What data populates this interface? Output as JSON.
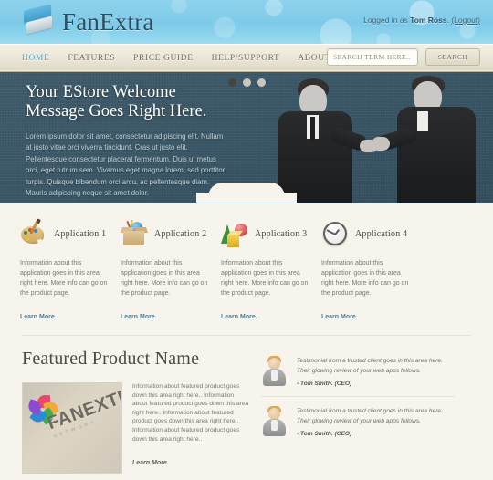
{
  "header": {
    "brand": "FanExtra",
    "logo_icon": "fanextra-logo-icon",
    "logged_in_prefix": "Logged in as ",
    "user_name": "Tom Ross",
    "logged_in_suffix": ". ",
    "logout_label": "(Logout)"
  },
  "nav": {
    "items": [
      {
        "label": "HOME",
        "active": true
      },
      {
        "label": "FEATURES",
        "active": false
      },
      {
        "label": "PRICE GUIDE",
        "active": false
      },
      {
        "label": "HELP/SUPPORT",
        "active": false
      },
      {
        "label": "ABOUT US",
        "active": false
      }
    ],
    "search_placeholder": "SEARCH TERM HERE..",
    "search_value": "",
    "search_button": "SEARCH"
  },
  "hero": {
    "title_line1": "Your EStore Welcome",
    "title_line2": "Message Goes Right Here.",
    "body": "Lorem ipsum dolor sit amet, consectetur adipiscing elit. Nullam at justo vitae orci viverra tincidunt. Cras ut justo elit. Pellentesque consectetur placerat fermentum. Duis ut metus orci, eget rutrum sem. Vivamus eget magna lorem, sed porttitor turpis. Quisque bibendum orci arcu, ac pellentesque diam. Mauris adipiscing neque sit amet dolor.",
    "image_alt": "two-businessmen-handshake-photo",
    "carousel_dots": 3,
    "carousel_active_index": 0
  },
  "apps": [
    {
      "title": "Application 1",
      "icon": "paint-palette-icon",
      "body": "Information about this application goes in this area right here. More info can go on the product page.",
      "link": "Learn More."
    },
    {
      "title": "Application 2",
      "icon": "open-box-package-icon",
      "body": "Information about this application goes in this area right here. More info can go on the product page.",
      "link": "Learn More."
    },
    {
      "title": "Application 3",
      "icon": "geometric-shapes-icon",
      "body": "Information about this application goes in this area right here. More info can go on the product page.",
      "link": "Learn More."
    },
    {
      "title": "Application 4",
      "icon": "clock-icon",
      "body": "Information about this application goes in this area right here. More info can go on the product page.",
      "link": "Learn More."
    }
  ],
  "featured": {
    "title": "Featured Product Name",
    "image_alt": "fanextra-network-product-image",
    "image_wordmark": "FANEXTRA",
    "image_subtext": "NETWORK",
    "body": "Information about featured product goes down this area right here.. Information about featured product goes down this area right here.. Information about featured product goes down this area right here.. Information about featured product goes down this area right here..",
    "link": "Learn More."
  },
  "testimonials": [
    {
      "avatar": "user-avatar-icon",
      "quote": "Testimonial from a trusted client goes in this area here. Their glowing review of your web apps follows.",
      "author": "- Tom Smith. (CEO)"
    },
    {
      "avatar": "user-avatar-icon",
      "quote": "Testimonial from a trusted client goes in this area here. Their glowing review of your web apps follows.",
      "author": "- Tom Smith. (CEO)"
    }
  ],
  "colors": {
    "header_blue": "#7ecae8",
    "nav_cream": "#ebe7d8",
    "hero_slate": "#3b5767",
    "page_cream": "#f6f4ec",
    "link_blue": "#4d7f96",
    "active_nav": "#4fa9cf"
  }
}
